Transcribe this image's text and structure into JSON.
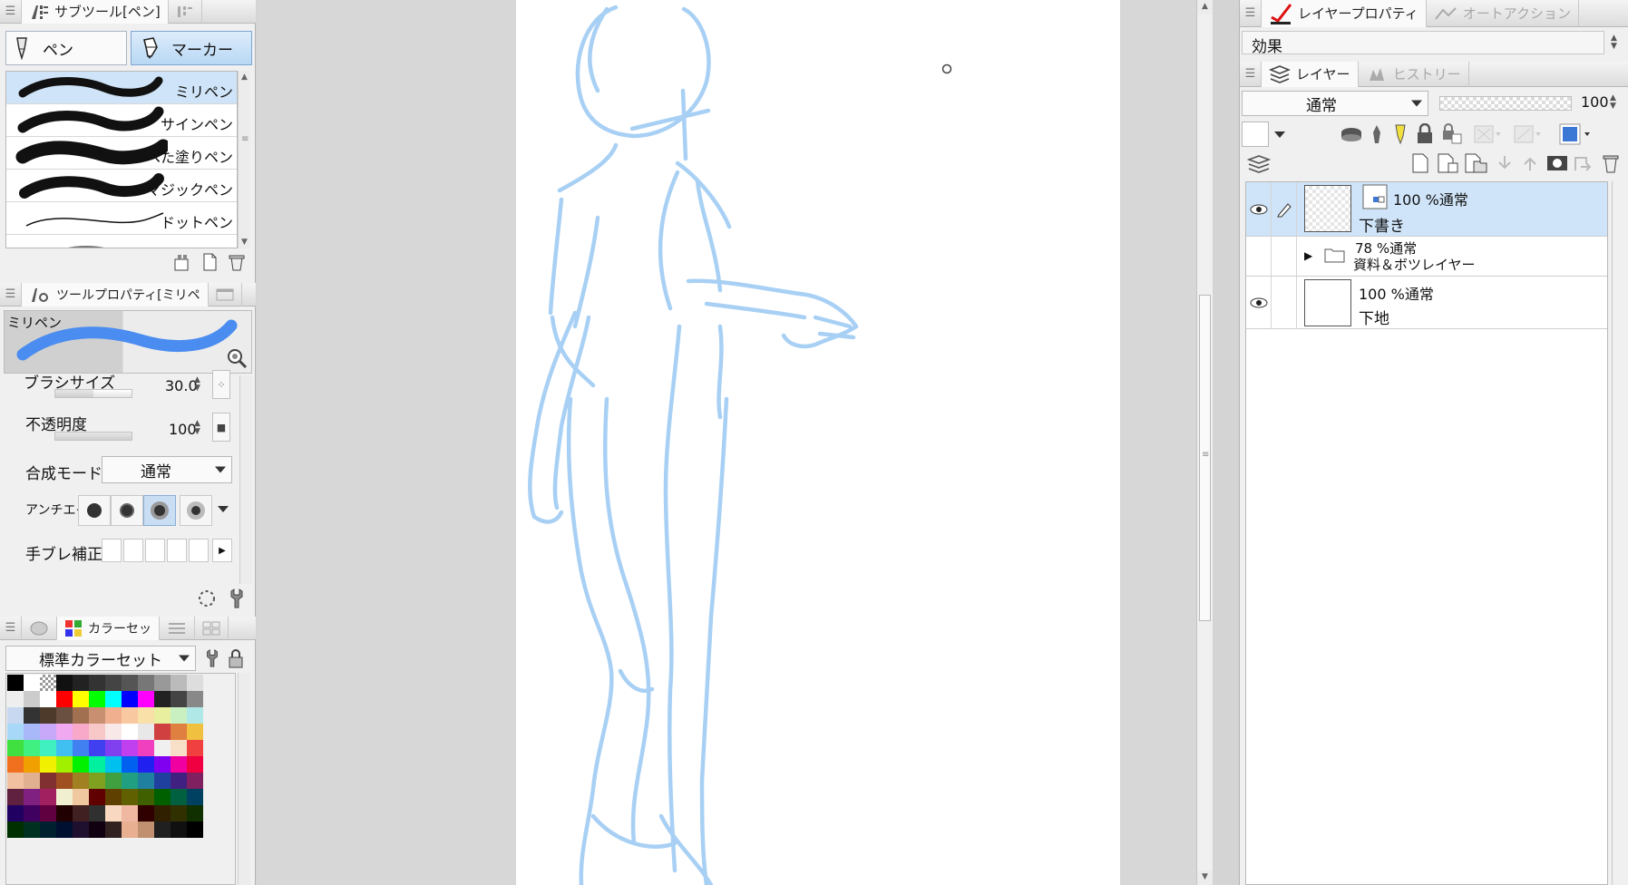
{
  "subtool_panel": {
    "tab_label": "サブツール[ペン]",
    "groups": [
      {
        "label": "ペン",
        "selected": false
      },
      {
        "label": "マーカー",
        "selected": true
      }
    ],
    "brushes": [
      {
        "name": "ミリペン",
        "selected": true
      },
      {
        "name": "サインペン",
        "selected": false
      },
      {
        "name": "べた塗りペン",
        "selected": false
      },
      {
        "name": "マジックペン",
        "selected": false
      },
      {
        "name": "ドットペン",
        "selected": false
      }
    ],
    "icons": [
      "copy-subtool-icon",
      "new-subtool-icon",
      "delete-icon"
    ]
  },
  "tool_property_panel": {
    "tab_label": "ツールプロパティ[ミリペ",
    "preview_label": "ミリペン",
    "preview_color": "#4a8cf0",
    "brush_size": {
      "label": "ブラシサイズ",
      "value": "30.0",
      "level": 0.5
    },
    "opacity": {
      "label": "不透明度",
      "value": "100",
      "level": 1.0
    },
    "blend_mode": {
      "label": "合成モード",
      "value": "通常"
    },
    "antialias": {
      "label": "アンチエイ",
      "options_count": 4,
      "selected_index": 2
    },
    "stabilization": {
      "label": "手ブレ補正",
      "level": 0
    }
  },
  "color_set_panel": {
    "tab_label": "カラーセッ",
    "set_name": "標準カラーセット",
    "swatches": [
      "#000000",
      "#ffffff",
      "checker",
      "#111111",
      "#222222",
      "#333333",
      "#444444",
      "#555555",
      "#777777",
      "#999999",
      "#bbbbbb",
      "#dddddd",
      "#eeeeee",
      "#cccccc",
      "#ffffff",
      "#ff0000",
      "#ffff00",
      "#00ff00",
      "#00ffff",
      "#0000ff",
      "#ff00ff",
      "#222222",
      "#444444",
      "#888888",
      "#c8d8f0",
      "#333333",
      "#4d3a2a",
      "#6a5040",
      "#a07050",
      "#c89070",
      "#f0b090",
      "#f8c8a0",
      "#f8e0a8",
      "#e8f0a0",
      "#c8f0c0",
      "#b0e8e8",
      "#a8d8f8",
      "#a8b8f8",
      "#c8a8f8",
      "#f0a8f0",
      "#f8a8c8",
      "#f8c8c8",
      "#f8e8e8",
      "#ffffff",
      "#e8e8e8",
      "#d04040",
      "#e08040",
      "#f0c040",
      "#40e040",
      "#40f080",
      "#40f0c0",
      "#40c0f0",
      "#4080f0",
      "#4040f0",
      "#8040f0",
      "#c040f0",
      "#f040c0",
      "#f0f0f0",
      "#f8e0c8",
      "#f04040",
      "#f07020",
      "#f0a000",
      "#f0f000",
      "#a0f000",
      "#00f000",
      "#00f0a0",
      "#00c0f0",
      "#0060f0",
      "#2020f0",
      "#8000f0",
      "#f000a0",
      "#f00040",
      "#f0c0a0",
      "#e0b090",
      "#803030",
      "#a05020",
      "#a08020",
      "#80a020",
      "#40a040",
      "#20a080",
      "#2080a0",
      "#2040a0",
      "#402080",
      "#802060",
      "#602040",
      "#802080",
      "#a02060",
      "#f0f0d0",
      "#f0c8a0",
      "#600000",
      "#604000",
      "#606000",
      "#406000",
      "#006000",
      "#006040",
      "#004060",
      "#200060",
      "#400060",
      "#600040",
      "#200000",
      "#402020",
      "#303030",
      "#f8d8c0",
      "#f0b8a0",
      "#300000",
      "#302000",
      "#303000",
      "#103000",
      "#003000",
      "#003020",
      "#002030",
      "#001030",
      "#201030",
      "#100010",
      "#302020",
      "#e8b090",
      "#c09070",
      "#202020",
      "#101010",
      "#000000"
    ]
  },
  "canvas": {
    "sketch_color": "#a8d0f4",
    "scrollbar_visible": true
  },
  "layer_property_panel": {
    "tab_label": "レイヤープロパティ",
    "tab2_label": "オートアクション",
    "effect_label": "効果"
  },
  "layer_panel": {
    "tab_label": "レイヤー",
    "tab2_label": "ヒストリー",
    "blend_mode": "通常",
    "opacity": "100",
    "layers": [
      {
        "opacity_blend": "100 %通常",
        "name": "下書き",
        "visible": true,
        "editing": true,
        "type": "raster",
        "selected": true
      },
      {
        "opacity_blend": "78 %通常",
        "name": "資料＆ボツレイヤー",
        "visible": false,
        "editing": false,
        "type": "folder",
        "selected": false
      },
      {
        "opacity_blend": "100 %通常",
        "name": "下地",
        "visible": true,
        "editing": false,
        "type": "paper",
        "selected": false
      }
    ]
  }
}
